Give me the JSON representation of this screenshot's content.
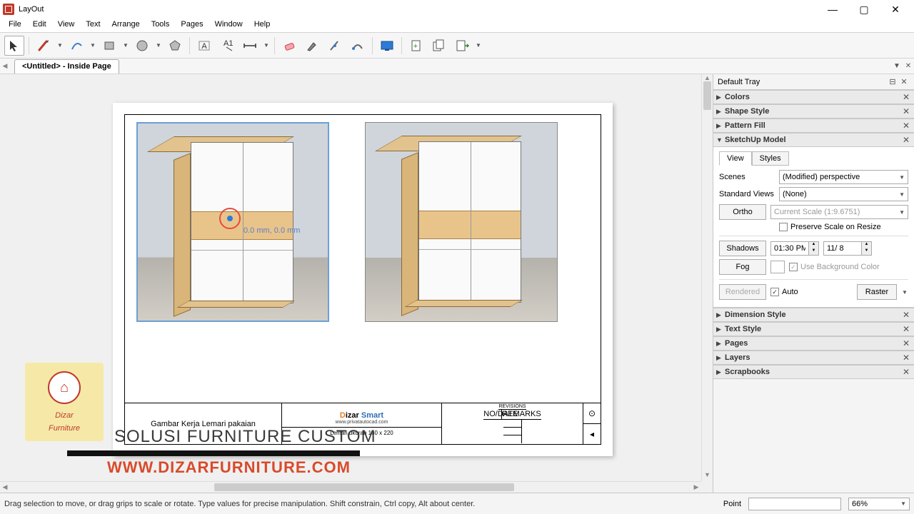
{
  "app": {
    "title": "LayOut"
  },
  "menu": [
    "File",
    "Edit",
    "View",
    "Text",
    "Arrange",
    "Tools",
    "Pages",
    "Window",
    "Help"
  ],
  "doctab": {
    "label": "<Untitled> - Inside Page"
  },
  "tray": {
    "title": "Default Tray",
    "panels_closed": [
      "Colors",
      "Shape Style",
      "Pattern Fill"
    ],
    "panel_open": "SketchUp Model",
    "panels_after": [
      "Dimension Style",
      "Text Style",
      "Pages",
      "Layers",
      "Scrapbooks"
    ],
    "su": {
      "tab_view": "View",
      "tab_styles": "Styles",
      "scenes_label": "Scenes",
      "scenes_value": "(Modified) perspective",
      "stdview_label": "Standard Views",
      "stdview_value": "(None)",
      "ortho_btn": "Ortho",
      "scale_value": "Current Scale (1:9.6751)",
      "preserve_label": "Preserve Scale on Resize",
      "shadows_btn": "Shadows",
      "shadows_time": "01:30 PM",
      "shadows_date": "11/ 8",
      "fog_btn": "Fog",
      "bgcolor_label": "Use Background Color",
      "rendered_btn": "Rendered",
      "auto_label": "Auto",
      "raster_btn": "Raster"
    }
  },
  "selection": {
    "coord_label": "0.0 mm, 0.0 mm"
  },
  "titleblock": {
    "drawing_title": "Gambar Kerja Lemari pakaian",
    "company": "Dizar Smart",
    "company_sub": "www.privatautocad.com",
    "desc": "Lemari ukuran 160 x 220",
    "rev_header": "REVISIONS",
    "rev_no": "NO/DATE",
    "rev_remark": "REMARKS"
  },
  "overlay": {
    "brand1": "Dizar",
    "brand2": "Furniture",
    "tagline": "SOLUSI FURNITURE CUSTOM",
    "url": "WWW.DIZARFURNITURE.COM"
  },
  "status": {
    "hint": "Drag selection to move, or drag grips to scale or rotate. Type values for precise manipulation. Shift constrain, Ctrl copy, Alt about center.",
    "field_label": "Point",
    "zoom": "66%"
  }
}
